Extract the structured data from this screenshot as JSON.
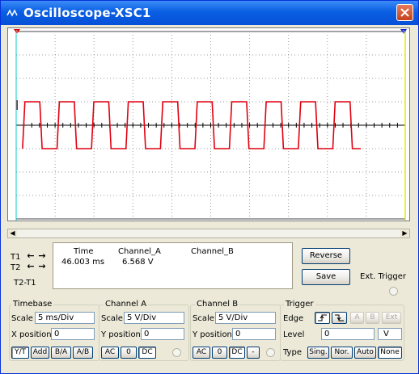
{
  "window": {
    "title": "Oscilloscope-XSC1"
  },
  "cursors": {
    "t1_label": "T1",
    "t2_label": "T2",
    "t2t1_label": "T2-T1"
  },
  "readout": {
    "headers": [
      "Time",
      "Channel_A",
      "Channel_B"
    ],
    "t1_row": [
      "46.003 ms",
      "6.568 V",
      ""
    ]
  },
  "actions": {
    "reverse": "Reverse",
    "save": "Save",
    "ext_trigger": "Ext. Trigger"
  },
  "timebase": {
    "title": "Timebase",
    "scale_label": "Scale",
    "scale_value": "5 ms/Div",
    "xpos_label": "X position",
    "xpos_value": "0",
    "modes": [
      "Y/T",
      "Add",
      "B/A",
      "A/B"
    ]
  },
  "channel_a": {
    "title": "Channel A",
    "scale_label": "Scale",
    "scale_value": "5  V/Div",
    "ypos_label": "Y position",
    "ypos_value": "0",
    "coupling": [
      "AC",
      "0",
      "DC"
    ]
  },
  "channel_b": {
    "title": "Channel B",
    "scale_label": "Scale",
    "scale_value": "5  V/Div",
    "ypos_label": "Y position",
    "ypos_value": "0",
    "coupling": [
      "AC",
      "0",
      "DC",
      "-"
    ]
  },
  "trigger": {
    "title": "Trigger",
    "edge_label": "Edge",
    "level_label": "Level",
    "level_value": "0",
    "level_unit": "V",
    "sources": [
      "A",
      "B",
      "Ext"
    ],
    "type_label": "Type",
    "types": [
      "Sing.",
      "Nor.",
      "Auto",
      "None"
    ]
  },
  "colors": {
    "trace_a": "#E0000F",
    "cursor_t1": "#00CCCC",
    "cursor_t2": "#E8E800",
    "titlebar": "#0A5FE2"
  },
  "waveform": {
    "low_v": -5,
    "high_v": 5,
    "cycles": 10,
    "period_ms": 4.43,
    "start_ms": 0.82,
    "duty": 0.5,
    "end_ms": 44.3,
    "rise_ms": 0.3
  }
}
